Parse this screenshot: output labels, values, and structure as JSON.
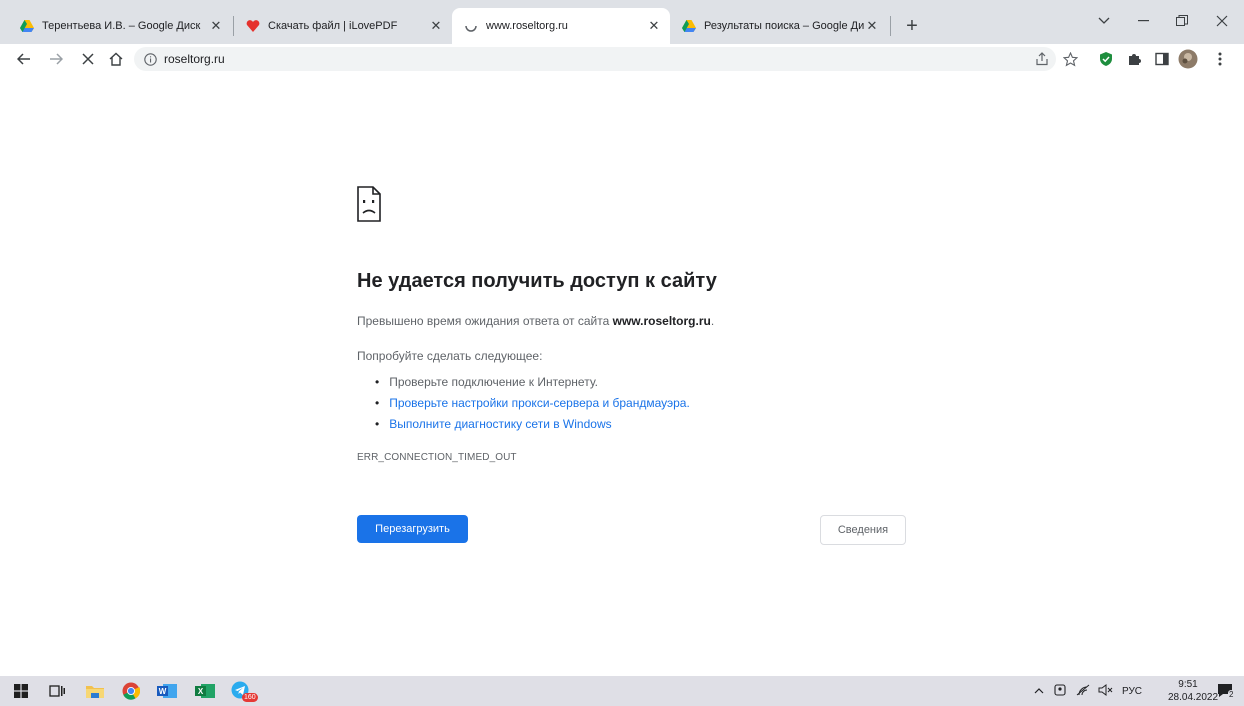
{
  "tabs": [
    {
      "title": "Терентьева И.В. – Google Диск",
      "icon": "google-drive-icon",
      "active": false
    },
    {
      "title": "Скачать файл | iLovePDF",
      "icon": "ilovepdf-icon",
      "active": false
    },
    {
      "title": "www.roseltorg.ru",
      "icon": "loading-spinner-icon",
      "active": true
    },
    {
      "title": "Результаты поиска – Google Ди",
      "icon": "google-drive-icon",
      "active": false
    }
  ],
  "address": {
    "url": "roseltorg.ru"
  },
  "error": {
    "heading": "Не удается получить доступ к сайту",
    "desc_prefix": "Превышено время ожидания ответа от сайта ",
    "desc_host": "www.roseltorg.ru",
    "desc_suffix": ".",
    "try_label": "Попробуйте сделать следующее:",
    "suggestions": [
      "Проверьте подключение к Интернету.",
      "Проверьте настройки прокси-сервера и брандмауэра.",
      "Выполните диагностику сети в Windows"
    ],
    "code": "ERR_CONNECTION_TIMED_OUT",
    "reload_label": "Перезагрузить",
    "details_label": "Сведения"
  },
  "taskbar": {
    "telegram_badge": "160",
    "lang": "РУС",
    "time": "9:51",
    "date": "28.04.2022",
    "notification_count": "2"
  },
  "colors": {
    "accent": "#1a73e8",
    "tabstrip": "#dee1e6",
    "taskbar": "#dfdfe6"
  }
}
